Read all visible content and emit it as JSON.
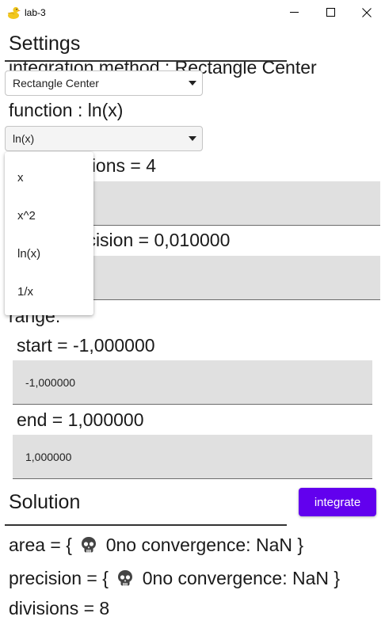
{
  "window": {
    "title": "lab-3"
  },
  "settings": {
    "heading": "Settings",
    "partial_heading": "integration method : Rectangle Center",
    "method_select": {
      "value": "Rectangle Center"
    },
    "function_label": "function : ln(x)",
    "function_select": {
      "value": "ln(x)",
      "options": [
        "x",
        "x^2",
        "ln(x)",
        "1/x"
      ]
    },
    "divisions_label": "initial divisions = 4",
    "divisions_input": "",
    "precision_label": "target precision = 0,010000",
    "precision_input": "",
    "range_label": "range:",
    "start_label": "start = -1,000000",
    "start_input": "-1,000000",
    "end_label": "end = 1,000000",
    "end_input": "1,000000"
  },
  "solution": {
    "heading": "Solution",
    "integrate_label": "integrate",
    "area_prefix": "area = {",
    "area_value": "0no convergence: NaN }",
    "precision_prefix": "precision = {",
    "precision_value": "0no convergence: NaN }",
    "divisions_text": "divisions = 8"
  },
  "colors": {
    "accent": "#6200ee",
    "field_bg": "#e0e0e0"
  },
  "icons": {
    "app": "duck-icon",
    "status": "skull-icon"
  }
}
